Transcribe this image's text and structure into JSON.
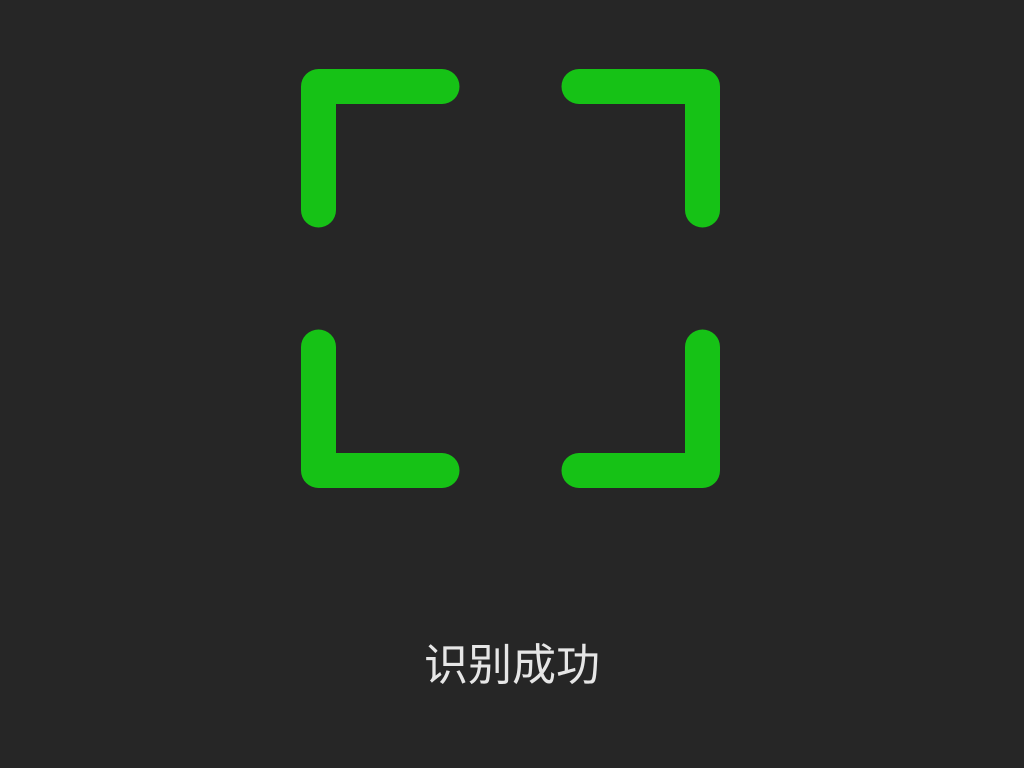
{
  "scanner": {
    "frame_icon": "scan-frame-icon",
    "frame_color": "#16c216",
    "background_color": "#262626"
  },
  "status": {
    "text": "识别成功"
  }
}
